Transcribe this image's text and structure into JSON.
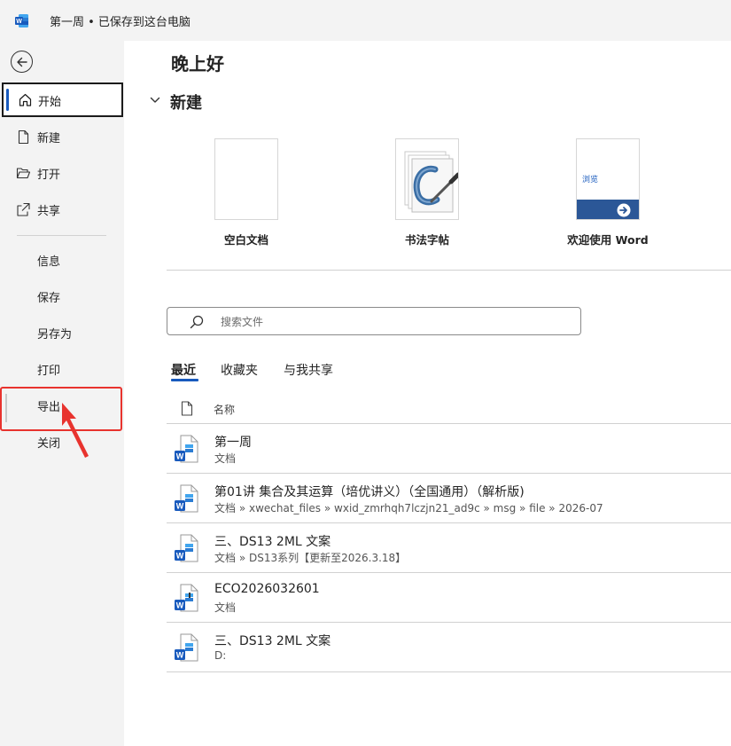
{
  "titlebar": {
    "app_icon": "word-icon",
    "document_title": "第一周 • 已保存到这台电脑"
  },
  "sidebar": {
    "back_icon": "back-arrow-icon",
    "items": [
      {
        "label": "开始",
        "icon": "home-icon"
      },
      {
        "label": "新建",
        "icon": "new-document-icon"
      },
      {
        "label": "打开",
        "icon": "folder-open-icon"
      },
      {
        "label": "共享",
        "icon": "share-icon"
      },
      {
        "label": "信息"
      },
      {
        "label": "保存"
      },
      {
        "label": "另存为"
      },
      {
        "label": "打印"
      },
      {
        "label": "导出"
      },
      {
        "label": "关闭"
      }
    ]
  },
  "main": {
    "greeting": "晚上好",
    "new_section": {
      "title": "新建",
      "templates": [
        {
          "label": "空白文档"
        },
        {
          "label": "书法字帖"
        },
        {
          "label": "欢迎使用 Word",
          "thumb_text": "浏览"
        }
      ]
    },
    "search": {
      "placeholder": "搜索文件"
    },
    "tabs": [
      "最近",
      "收藏夹",
      "与我共享"
    ],
    "file_list": {
      "column_name": "名称",
      "rows": [
        {
          "name": "第一周",
          "path": "文档"
        },
        {
          "name": "第01讲 集合及其运算（培优讲义）（全国通用）（解析版)",
          "path": "文档 » xwechat_files » wxid_zmrhqh7lczjn21_ad9c » msg » file » 2026-07"
        },
        {
          "name": "三、DS13 2ML 文案",
          "path": "文档 » DS13系列【更新至2026.3.18】"
        },
        {
          "name": "ECO2026032601",
          "path": "文档"
        },
        {
          "name": "三、DS13 2ML 文案",
          "path": "D:"
        }
      ]
    }
  },
  "colors": {
    "word_blue": "#185abd",
    "sidebar_bg": "#f3f3f3",
    "annotation_red": "#e8332e"
  }
}
